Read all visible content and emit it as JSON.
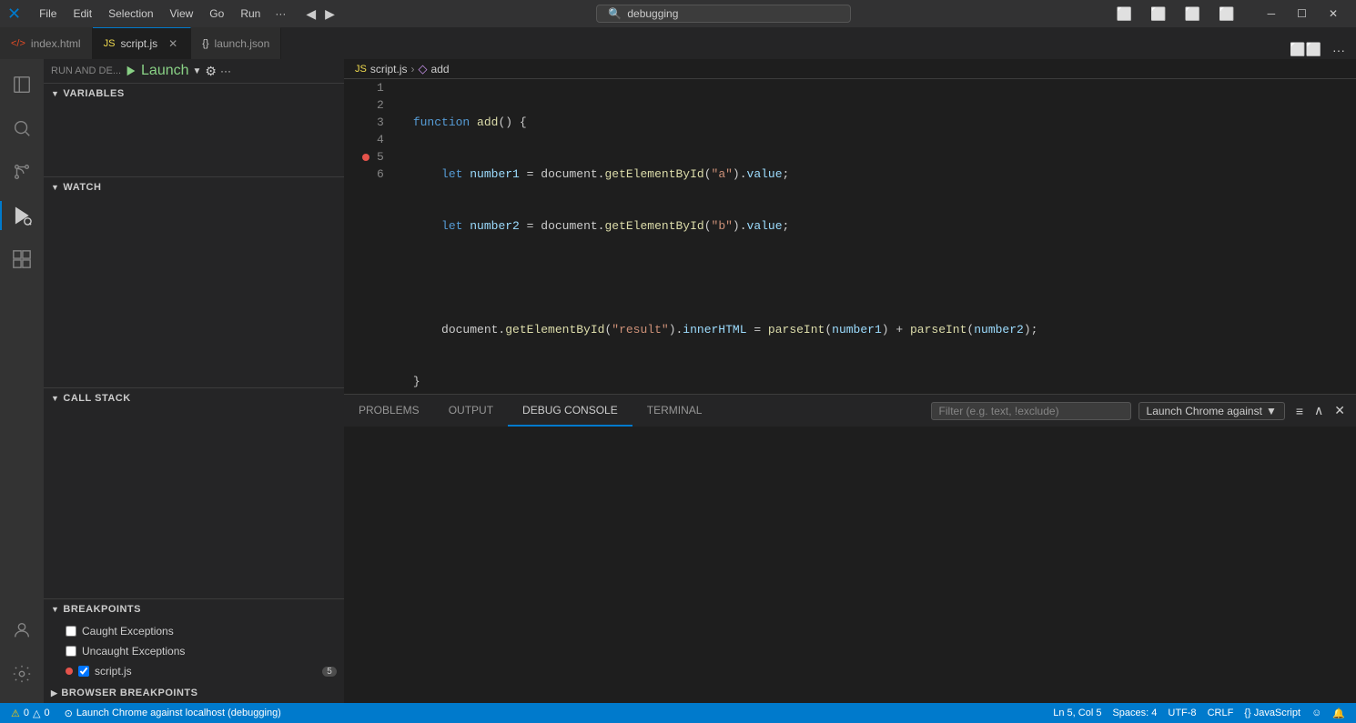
{
  "titlebar": {
    "logo": "X",
    "menus": [
      "File",
      "Edit",
      "Selection",
      "View",
      "Go",
      "Run"
    ],
    "more": "···",
    "nav_back": "‹",
    "nav_forward": "›",
    "search_text": "debugging",
    "search_placeholder": "debugging",
    "layout_icons": [
      "⬜",
      "⬜",
      "⬜",
      "⬜"
    ],
    "win_minimize": "─",
    "win_maximize": "☐",
    "win_close": "✕"
  },
  "tabs": [
    {
      "id": "index",
      "icon": "html",
      "icon_symbol": "</>",
      "label": "index.html",
      "closable": false
    },
    {
      "id": "script",
      "icon": "js",
      "icon_symbol": "JS",
      "label": "script.js",
      "closable": true,
      "active": true
    },
    {
      "id": "launch",
      "icon": "json",
      "icon_symbol": "{}",
      "label": "launch.json",
      "closable": false
    }
  ],
  "breadcrumb": {
    "file_icon": "JS",
    "file": "script.js",
    "sep": ">",
    "func_icon": "◇",
    "func": "add"
  },
  "sidebar": {
    "run_label": "RUN AND DE...",
    "launch_label": "Launch",
    "gear_label": "⚙",
    "more_label": "···",
    "sections": {
      "variables": {
        "label": "VARIABLES",
        "expanded": true
      },
      "watch": {
        "label": "WATCH",
        "expanded": true
      },
      "callstack": {
        "label": "CALL STACK",
        "expanded": true
      },
      "breakpoints": {
        "label": "BREAKPOINTS",
        "expanded": true
      }
    },
    "breakpoints": {
      "caught": {
        "label": "Caught Exceptions",
        "checked": false
      },
      "uncaught": {
        "label": "Uncaught Exceptions",
        "checked": false
      },
      "script": {
        "label": "script.js",
        "checked": true,
        "count": "5",
        "has_dot": true
      }
    },
    "browser_breakpoints": {
      "label": "BROWSER BREAKPOINTS",
      "expanded": false
    }
  },
  "code": {
    "lines": [
      {
        "num": 1,
        "content": "function add() {",
        "breakpoint": false
      },
      {
        "num": 2,
        "content": "    let number1 = document.getElementById(\"a\").value;",
        "breakpoint": false
      },
      {
        "num": 3,
        "content": "    let number2 = document.getElementById(\"b\").value;",
        "breakpoint": false
      },
      {
        "num": 4,
        "content": "",
        "breakpoint": false
      },
      {
        "num": 5,
        "content": "    document.getElementById(\"result\").innerHTML = parseInt(number1) + parseInt(number2);",
        "breakpoint": true
      },
      {
        "num": 6,
        "content": "}",
        "breakpoint": false
      }
    ]
  },
  "panel": {
    "tabs": [
      {
        "id": "problems",
        "label": "PROBLEMS"
      },
      {
        "id": "output",
        "label": "OUTPUT"
      },
      {
        "id": "debug_console",
        "label": "DEBUG CONSOLE",
        "active": true
      },
      {
        "id": "terminal",
        "label": "TERMINAL"
      }
    ],
    "filter_placeholder": "Filter (e.g. text, !exclude)",
    "dropdown_label": "Launch Chrome against",
    "close_icon": "✕"
  },
  "statusbar": {
    "errors": "⚠ 0",
    "warnings": "△ 0",
    "debug_launch": "Launch Chrome against localhost (debugging)",
    "position": "Ln 5, Col 5",
    "spaces": "Spaces: 4",
    "encoding": "UTF-8",
    "line_ending": "CRLF",
    "language": "{} JavaScript",
    "feedback_icon": "☺",
    "notification_icon": "🔔"
  }
}
